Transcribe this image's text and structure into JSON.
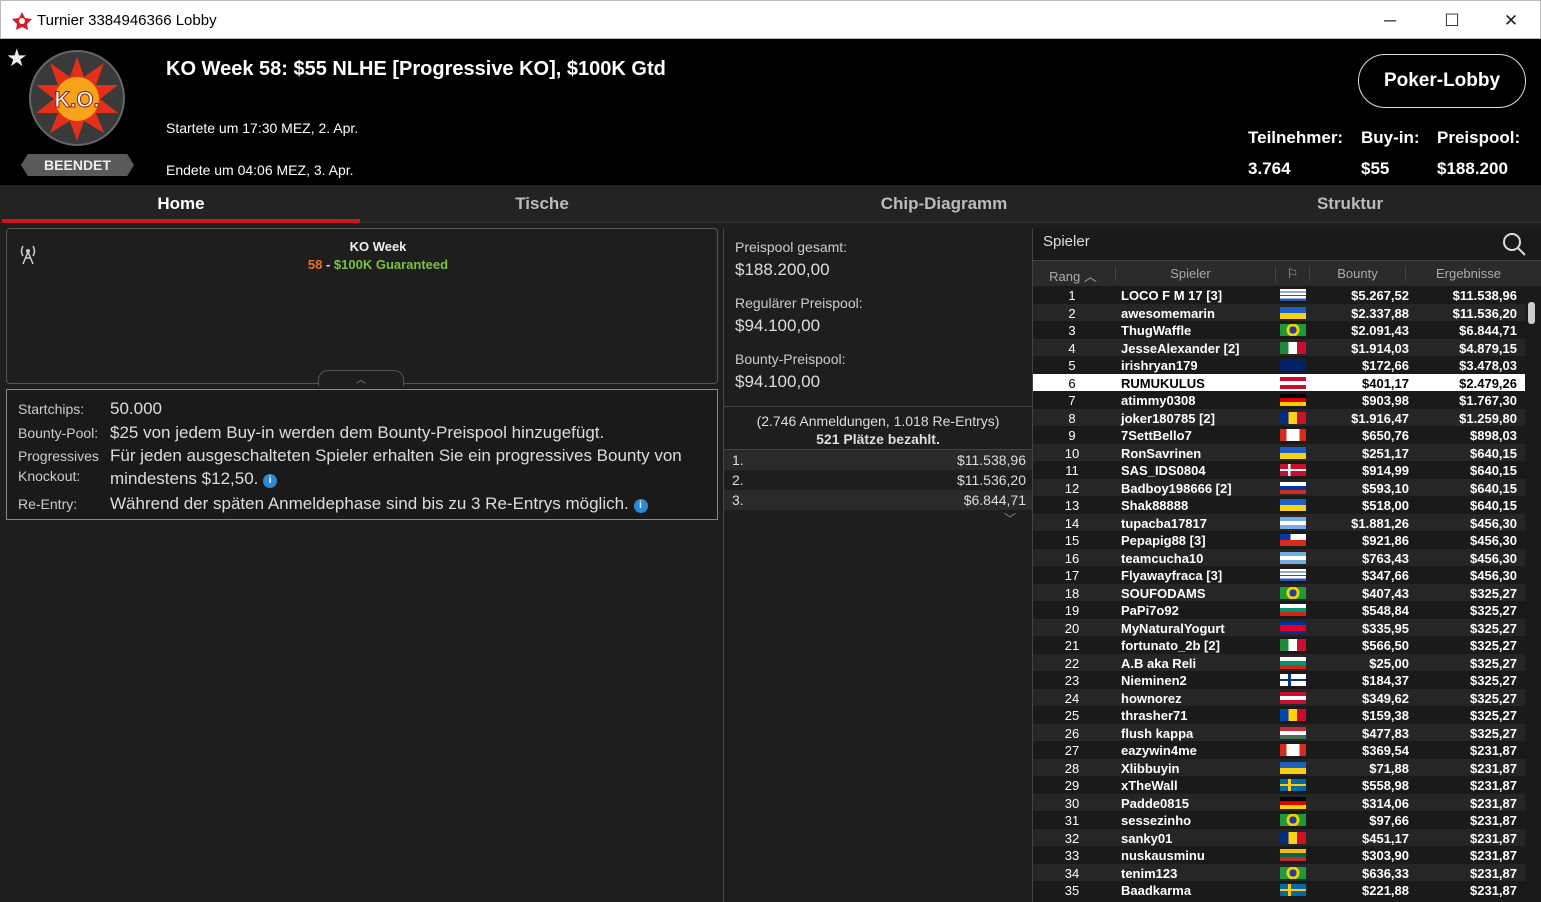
{
  "window": {
    "title": "Turnier 3384946366 Lobby",
    "minimize": "─",
    "maximize": "☐",
    "close": "✕"
  },
  "header": {
    "status": "BEENDET",
    "logo_text": "K.O.",
    "name": "KO Week 58: $55 NLHE [Progressive KO], $100K Gtd",
    "start": "Startete um 17:30 MEZ, 2. Apr.",
    "end": "Endete um 04:06 MEZ, 3. Apr.",
    "lobby_button": "Poker-Lobby",
    "stats": {
      "participants_label": "Teilnehmer:",
      "participants": "3.764",
      "buyin_label": "Buy-in:",
      "buyin": "$55",
      "prizepool_label": "Preispool:",
      "prizepool": "$188.200"
    }
  },
  "tabs": [
    "Home",
    "Tische",
    "Chip-Diagramm",
    "Struktur"
  ],
  "info": {
    "title": "KO Week",
    "sub_num": "58",
    "sub_sep": " - ",
    "sub_text": "$100K Guaranteed",
    "startchips_label": "Startchips:",
    "startchips": "50.000",
    "bounty_label": "Bounty-Pool:",
    "bounty": "$25 von jedem Buy-in werden dem Bounty-Preispool hinzugefügt.",
    "pko_label1": "Progressives",
    "pko_label2": "Knockout:",
    "pko": "Für jeden ausgeschalteten Spieler erhalten Sie ein progressives Bounty von mindestens $12,50.",
    "reentry_label": "Re-Entry:",
    "reentry": "Während der späten Anmeldephase sind bis zu 3 Re-Entrys möglich."
  },
  "pool": {
    "total_label": "Preispool gesamt:",
    "total": "$188.200,00",
    "regular_label": "Regulärer Preispool:",
    "regular": "$94.100,00",
    "bounty_label": "Bounty-Preispool:",
    "bounty": "$94.100,00",
    "registrations": "(2.746 Anmeldungen, 1.018 Re-Entrys)",
    "paid": "521 Plätze bezahlt.",
    "payouts": [
      {
        "place": "1.",
        "amount": "$11.538,96"
      },
      {
        "place": "2.",
        "amount": "$11.536,20"
      },
      {
        "place": "3.",
        "amount": "$6.844,71"
      }
    ]
  },
  "players": {
    "search_placeholder": "Spieler",
    "headers": {
      "rank": "Rang",
      "player": "Spieler",
      "bounty": "Bounty",
      "result": "Ergebnisse"
    },
    "selected_rank": 6,
    "rows": [
      [
        "1",
        "LOCO F M 17 [3]",
        "uy",
        "$5.267,52",
        "$11.538,96"
      ],
      [
        "2",
        "awesomemarin",
        "ua",
        "$2.337,88",
        "$11.536,20"
      ],
      [
        "3",
        "ThugWaffle",
        "br",
        "$2.091,43",
        "$6.844,71"
      ],
      [
        "4",
        "JesseAlexander [2]",
        "mx",
        "$1.914,03",
        "$4.879,15"
      ],
      [
        "5",
        "irishryan179",
        "gb",
        "$172,66",
        "$3.478,03"
      ],
      [
        "6",
        "RUMUKULUS",
        "at",
        "$401,17",
        "$2.479,26"
      ],
      [
        "7",
        "atimmy0308",
        "de",
        "$903,98",
        "$1.767,30"
      ],
      [
        "8",
        "joker180785 [2]",
        "ro",
        "$1.916,47",
        "$1.259,80"
      ],
      [
        "9",
        "7SettBello7",
        "ca",
        "$650,76",
        "$898,03"
      ],
      [
        "10",
        "RonSavrinen",
        "ua",
        "$251,17",
        "$640,15"
      ],
      [
        "11",
        "SAS_IDS0804",
        "dk",
        "$914,99",
        "$640,15"
      ],
      [
        "12",
        "Badboy198666 [2]",
        "ru",
        "$593,10",
        "$640,15"
      ],
      [
        "13",
        "Shak88888",
        "ua",
        "$518,00",
        "$640,15"
      ],
      [
        "14",
        "tupacba17817",
        "ar",
        "$1.881,26",
        "$456,30"
      ],
      [
        "15",
        "Pepapig88 [3]",
        "cl",
        "$921,86",
        "$456,30"
      ],
      [
        "16",
        "teamcucha10",
        "ar",
        "$763,43",
        "$456,30"
      ],
      [
        "17",
        "Flyawayfraca [3]",
        "uy",
        "$347,66",
        "$456,30"
      ],
      [
        "18",
        "SOUFODAMS",
        "br",
        "$407,43",
        "$325,27"
      ],
      [
        "19",
        "PaPi7o92",
        "bg",
        "$548,84",
        "$325,27"
      ],
      [
        "20",
        "MyNaturalYogurt",
        "kh",
        "$335,95",
        "$325,27"
      ],
      [
        "21",
        "fortunato_2b [2]",
        "mx",
        "$566,50",
        "$325,27"
      ],
      [
        "22",
        "A.B aka Reli",
        "bg",
        "$25,00",
        "$325,27"
      ],
      [
        "23",
        "Nieminen2",
        "fi",
        "$184,37",
        "$325,27"
      ],
      [
        "24",
        "hownorez",
        "at",
        "$349,62",
        "$325,27"
      ],
      [
        "25",
        "thrasher71",
        "md",
        "$159,38",
        "$325,27"
      ],
      [
        "26",
        "flush kappa",
        "hu",
        "$477,83",
        "$325,27"
      ],
      [
        "27",
        "eazywin4me",
        "ca",
        "$369,54",
        "$231,87"
      ],
      [
        "28",
        "Xlibbuyin",
        "ua",
        "$71,88",
        "$231,87"
      ],
      [
        "29",
        "xTheWall",
        "se",
        "$558,98",
        "$231,87"
      ],
      [
        "30",
        "Padde0815",
        "de",
        "$314,06",
        "$231,87"
      ],
      [
        "31",
        "sessezinho",
        "br",
        "$97,66",
        "$231,87"
      ],
      [
        "32",
        "sanky01",
        "ro",
        "$451,17",
        "$231,87"
      ],
      [
        "33",
        "nuskausminu",
        "lt",
        "$303,90",
        "$231,87"
      ],
      [
        "34",
        "tenim123",
        "br",
        "$636,33",
        "$231,87"
      ],
      [
        "35",
        "Baadkarma",
        "se",
        "$221,88",
        "$231,87"
      ]
    ]
  },
  "colors": {
    "accent_red": "#c9161d",
    "sub_num": "#e8702a",
    "sub_text": "#7ac143"
  }
}
